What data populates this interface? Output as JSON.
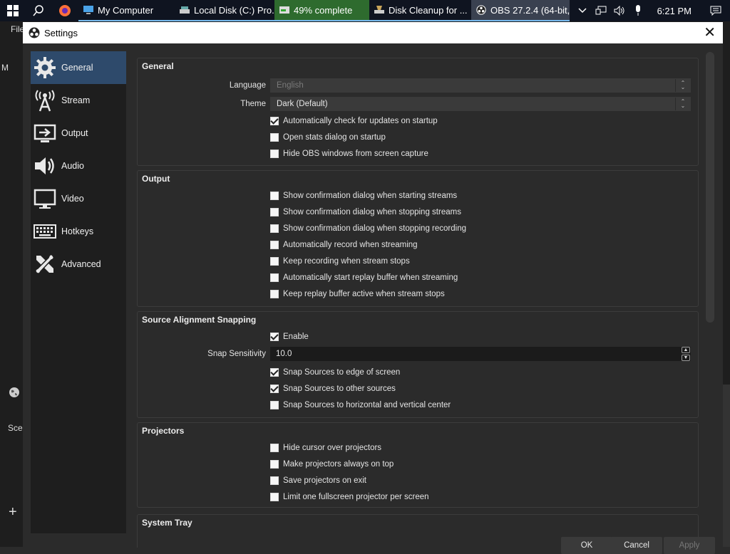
{
  "taskbar": {
    "apps": [
      {
        "label": "My Computer",
        "icon": "computer-icon"
      },
      {
        "label": "Local Disk (C:) Pro...",
        "icon": "drive-icon"
      },
      {
        "label": "49% complete",
        "icon": "copy-progress-icon"
      },
      {
        "label": "Disk Cleanup for ...",
        "icon": "disk-cleanup-icon"
      },
      {
        "label": "OBS 27.2.4 (64-bit,...",
        "icon": "obs-icon"
      }
    ],
    "clock": "6:21 PM",
    "progress_color": "#2e6b2e"
  },
  "background": {
    "menu_file": "File",
    "left_letter": "M",
    "scenes_label": "Sce"
  },
  "dialog": {
    "title": "Settings",
    "sidebar": [
      {
        "label": "General",
        "icon": "gear-icon",
        "selected": true
      },
      {
        "label": "Stream",
        "icon": "broadcast-antenna-icon"
      },
      {
        "label": "Output",
        "icon": "output-icon"
      },
      {
        "label": "Audio",
        "icon": "speaker-icon"
      },
      {
        "label": "Video",
        "icon": "monitor-icon"
      },
      {
        "label": "Hotkeys",
        "icon": "keyboard-icon"
      },
      {
        "label": "Advanced",
        "icon": "tools-icon"
      }
    ],
    "general": {
      "title": "General",
      "language_label": "Language",
      "language_value": "English",
      "theme_label": "Theme",
      "theme_value": "Dark (Default)",
      "checks": [
        {
          "label": "Automatically check for updates on startup",
          "checked": true
        },
        {
          "label": "Open stats dialog on startup",
          "checked": false
        },
        {
          "label": "Hide OBS windows from screen capture",
          "checked": false
        }
      ]
    },
    "output": {
      "title": "Output",
      "checks": [
        {
          "label": "Show confirmation dialog when starting streams",
          "checked": false
        },
        {
          "label": "Show confirmation dialog when stopping streams",
          "checked": false
        },
        {
          "label": "Show confirmation dialog when stopping recording",
          "checked": false
        },
        {
          "label": "Automatically record when streaming",
          "checked": false
        },
        {
          "label": "Keep recording when stream stops",
          "checked": false
        },
        {
          "label": "Automatically start replay buffer when streaming",
          "checked": false
        },
        {
          "label": "Keep replay buffer active when stream stops",
          "checked": false
        }
      ]
    },
    "snapping": {
      "title": "Source Alignment Snapping",
      "enable_label": "Enable",
      "enable_checked": true,
      "sensitivity_label": "Snap Sensitivity",
      "sensitivity_value": "10.0",
      "checks": [
        {
          "label": "Snap Sources to edge of screen",
          "checked": true
        },
        {
          "label": "Snap Sources to other sources",
          "checked": true
        },
        {
          "label": "Snap Sources to horizontal and vertical center",
          "checked": false
        }
      ]
    },
    "projectors": {
      "title": "Projectors",
      "checks": [
        {
          "label": "Hide cursor over projectors",
          "checked": false
        },
        {
          "label": "Make projectors always on top",
          "checked": false
        },
        {
          "label": "Save projectors on exit",
          "checked": false
        },
        {
          "label": "Limit one fullscreen projector per screen",
          "checked": false
        }
      ]
    },
    "system_tray": {
      "title": "System Tray"
    },
    "buttons": {
      "ok": "OK",
      "cancel": "Cancel",
      "apply": "Apply"
    }
  }
}
